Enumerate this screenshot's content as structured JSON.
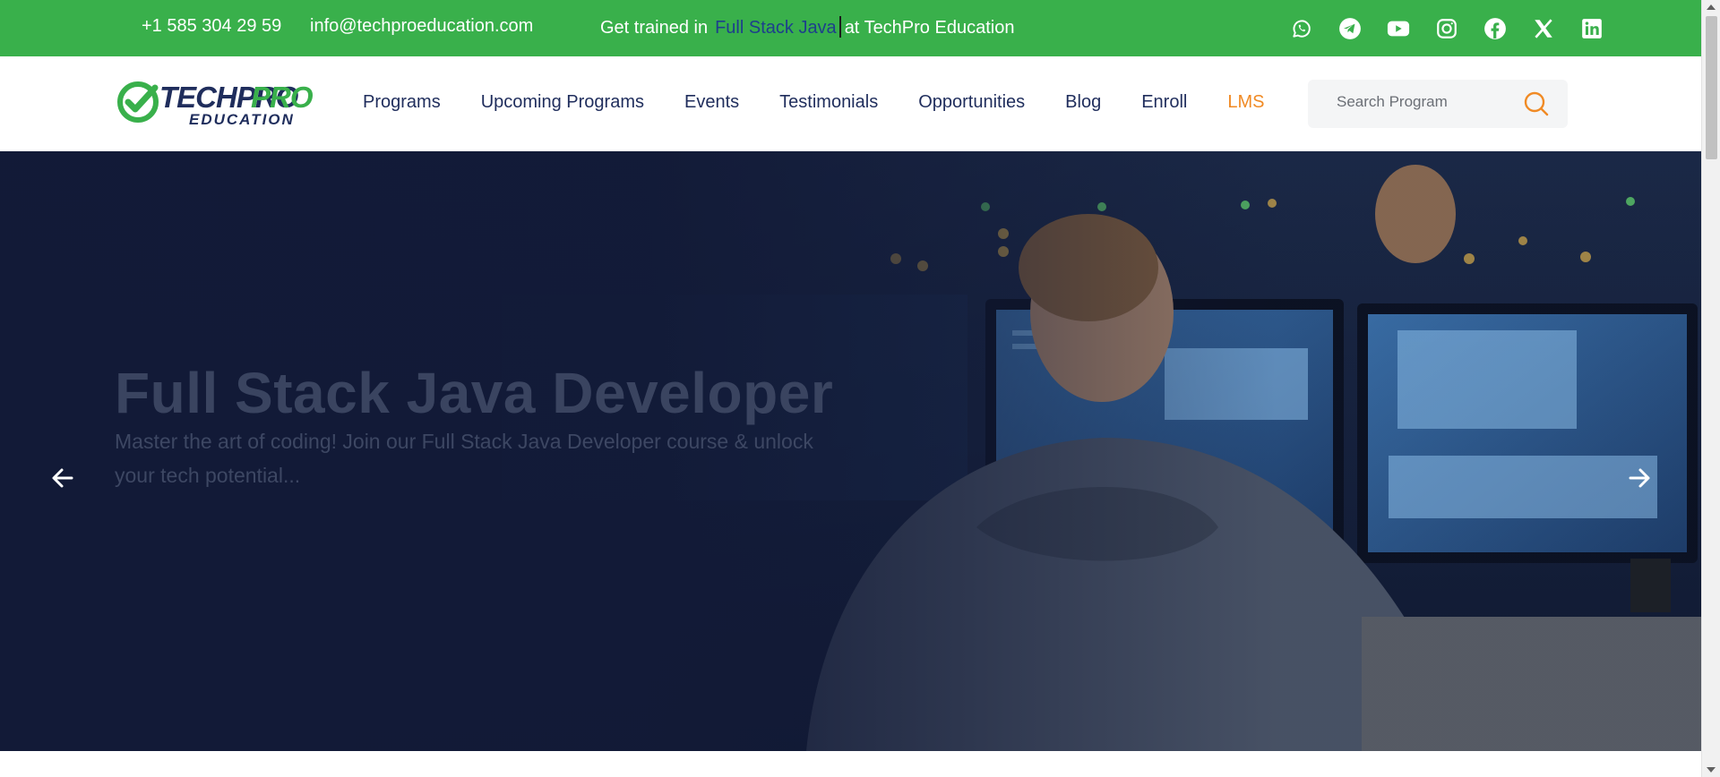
{
  "topbar": {
    "phone": "+1 585 304 29 59",
    "email": "info@techproeducation.com",
    "tagline_prefix": "Get trained in",
    "tagline_highlight": "Full Stack Java",
    "tagline_suffix": "at TechPro Education",
    "background_color": "#39b04b",
    "social_icons": [
      "whatsapp-icon",
      "telegram-icon",
      "youtube-icon",
      "instagram-icon",
      "facebook-icon",
      "x-icon",
      "linkedin-icon"
    ]
  },
  "header": {
    "logo_text_top": "TECHPRO",
    "logo_text_bottom": "EDUCATION",
    "nav": {
      "programs": "Programs",
      "upcoming": "Upcoming Programs",
      "events": "Events",
      "testimonials": "Testimonials",
      "opportunities": "Opportunities",
      "blog": "Blog",
      "enroll": "Enroll",
      "lms": "LMS"
    },
    "search_placeholder": "Search Program",
    "accent_color": "#f08a24",
    "nav_color": "#1f2d5c"
  },
  "hero": {
    "title": "Full Stack Java Developer",
    "description": "Master the art of coding! Join our Full Stack Java Developer course & unlock your tech potential..."
  }
}
